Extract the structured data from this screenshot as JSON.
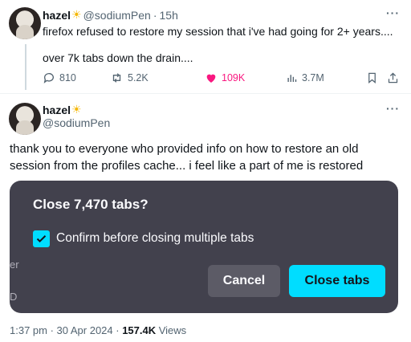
{
  "tweet1": {
    "name": "hazel",
    "handle": "@sodiumPen",
    "sep": "·",
    "time": "15h",
    "line1": "firefox refused to restore my session that i've had going for 2+ years....",
    "line2": "over 7k tabs down the drain....",
    "replies": "810",
    "reposts": "5.2K",
    "likes": "109K",
    "views": "3.7M"
  },
  "tweet2": {
    "name": "hazel",
    "handle": "@sodiumPen",
    "text": "thank you to everyone who provided info on how to restore an old session from the profiles cache... i feel like  a part of me is restored",
    "timestamp": "1:37 pm · 30 Apr 2024 · ",
    "views_count": "157.4K",
    "views_label": " Views"
  },
  "dialog": {
    "title": "Close 7,470 tabs?",
    "checkbox_label": "Confirm before closing multiple tabs",
    "checked": true,
    "cancel_label": "Cancel",
    "confirm_label": "Close tabs",
    "edge_text_1": "er",
    "edge_text_2": "D"
  },
  "icons": {
    "more": "more-dots-icon",
    "sun": "sun-emoji-icon",
    "reply": "reply-bubble-icon",
    "repost": "repost-arrows-icon",
    "like": "heart-icon",
    "views": "bar-chart-icon",
    "bookmark": "bookmark-icon",
    "share": "share-icon",
    "check": "checkmark-icon"
  },
  "colors": {
    "like": "#f91880",
    "dialog_bg": "#42414d",
    "accent": "#00ddff",
    "cancel_bg": "#5c5b66"
  }
}
